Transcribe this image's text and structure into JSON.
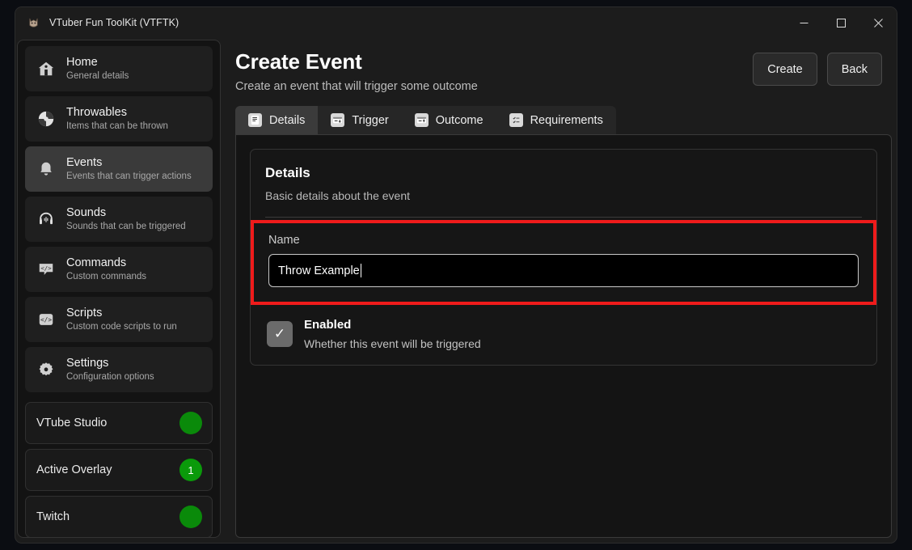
{
  "window": {
    "title": "VTuber Fun ToolKit (VTFTK)",
    "app_icon": "app-logo-icon",
    "controls": {
      "minimize": "minimize-icon",
      "maximize": "maximize-icon",
      "close": "close-icon"
    }
  },
  "sidebar": {
    "items": [
      {
        "label": "Home",
        "sub": "General details",
        "icon": "home-icon",
        "active": false
      },
      {
        "label": "Throwables",
        "sub": "Items that can be thrown",
        "icon": "ball-icon",
        "active": false
      },
      {
        "label": "Events",
        "sub": "Events that can trigger actions",
        "icon": "bell-icon",
        "active": true
      },
      {
        "label": "Sounds",
        "sub": "Sounds that can be triggered",
        "icon": "headphones-icon",
        "active": false
      },
      {
        "label": "Commands",
        "sub": "Custom commands",
        "icon": "code-chat-icon",
        "active": false
      },
      {
        "label": "Scripts",
        "sub": "Custom code scripts to run",
        "icon": "code-icon",
        "active": false
      },
      {
        "label": "Settings",
        "sub": "Configuration options",
        "icon": "gear-icon",
        "active": false
      }
    ],
    "status": [
      {
        "label": "VTube Studio",
        "badge": "",
        "color": "#0a8a0a"
      },
      {
        "label": "Active Overlay",
        "badge": "1",
        "color": "#0a9a0a"
      },
      {
        "label": "Twitch",
        "badge": "",
        "color": "#0a8a0a"
      }
    ]
  },
  "header": {
    "title": "Create Event",
    "subtitle": "Create an event that will trigger some outcome",
    "create_label": "Create",
    "back_label": "Back"
  },
  "tabs": [
    {
      "label": "Details",
      "icon": "document-icon",
      "active": true
    },
    {
      "label": "Trigger",
      "icon": "input-down-icon",
      "active": false
    },
    {
      "label": "Outcome",
      "icon": "input-up-icon",
      "active": false
    },
    {
      "label": "Requirements",
      "icon": "checklist-icon",
      "active": false
    }
  ],
  "details_card": {
    "title": "Details",
    "subtitle": "Basic details about the event",
    "name_label": "Name",
    "name_value": "Throw Example",
    "name_placeholder": "",
    "enabled_title": "Enabled",
    "enabled_sub": "Whether this event will be triggered",
    "enabled_checked": true,
    "checkbox_glyph": "✓"
  },
  "highlight": {
    "color": "#ef1b1b"
  }
}
